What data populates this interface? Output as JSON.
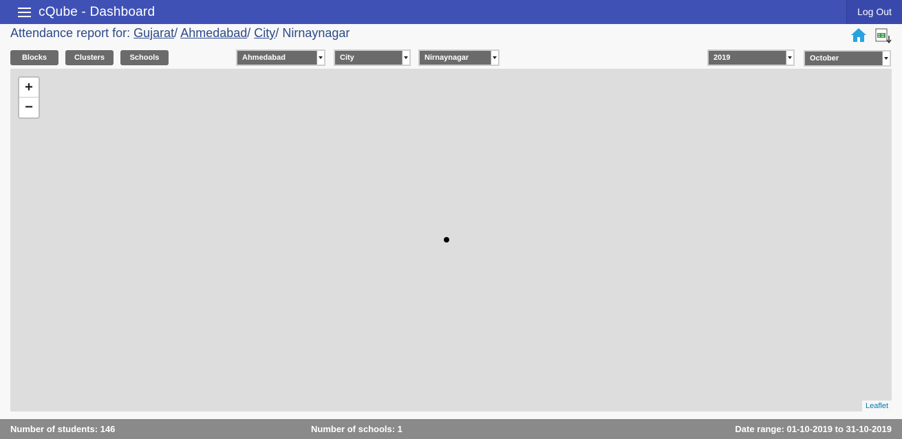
{
  "app": {
    "title": "cQube - Dashboard",
    "logout_label": "Log Out"
  },
  "breadcrumb": {
    "prefix": "Attendance report for:",
    "state": "Gujarat",
    "district": "Ahmedabad",
    "block": "City",
    "cluster": "Nirnaynagar",
    "separator": "/"
  },
  "icons": {
    "home": "home-icon",
    "download": "csv-download-icon"
  },
  "level_buttons": {
    "blocks": "Blocks",
    "clusters": "Clusters",
    "schools": "Schools"
  },
  "filters": {
    "district": "Ahmedabad",
    "block": "City",
    "cluster": "Nirnaynagar",
    "year": "2019",
    "month": "October"
  },
  "map": {
    "zoom_in": "+",
    "zoom_out": "−",
    "attribution": "Leaflet"
  },
  "footer": {
    "students": "Number of students: 146",
    "schools": "Number of schools: 1",
    "date_range": "Date range: 01-10-2019 to 31-10-2019"
  },
  "colors": {
    "header": "#3f51b5",
    "accent": "#2c4a8a",
    "icon": "#29a3e0",
    "footer": "#8a8a8a"
  }
}
